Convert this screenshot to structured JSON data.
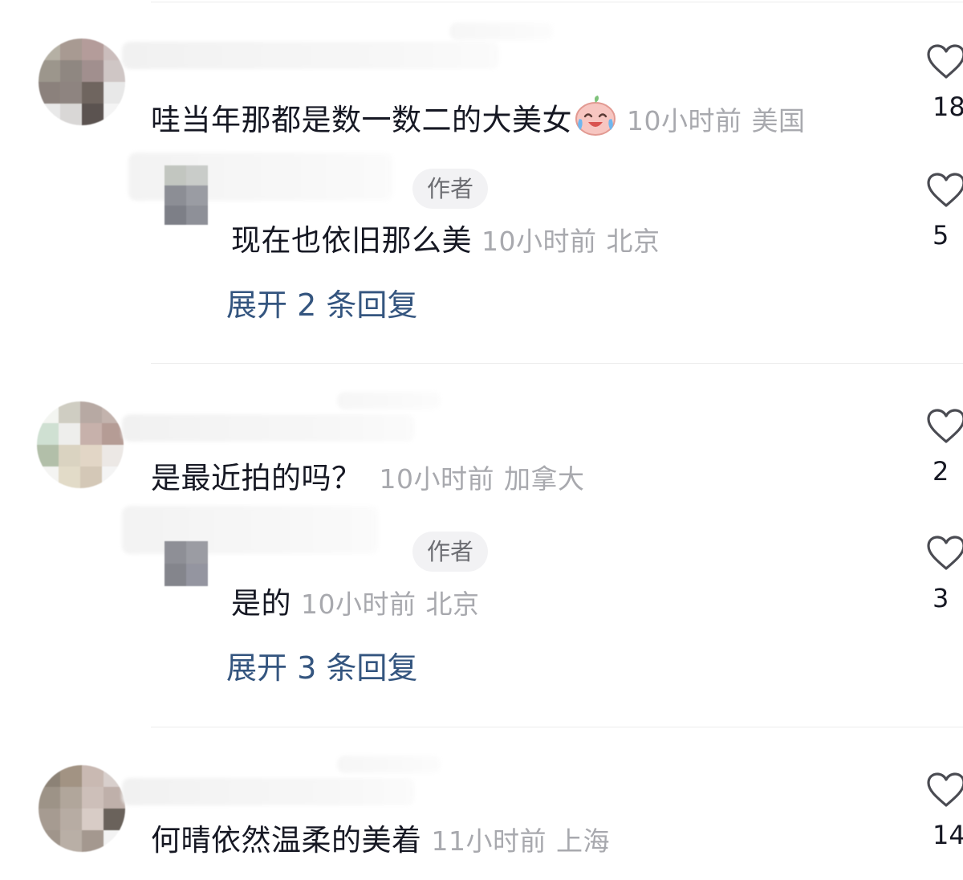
{
  "comments": [
    {
      "text": "哇当年那都是数一数二的大美女",
      "emoji": "crying-laughing-emoji",
      "time": "10小时前",
      "location": "美国",
      "likes": "18",
      "reply": {
        "author_tag": "作者",
        "text": "现在也依旧那么美",
        "time": "10小时前",
        "location": "北京",
        "likes": "5"
      },
      "expand_label": "展开 2 条回复"
    },
    {
      "text": "是最近拍的吗？",
      "time": "10小时前",
      "location": "加拿大",
      "likes": "2",
      "reply": {
        "author_tag": "作者",
        "text": "是的",
        "time": "10小时前",
        "location": "北京",
        "likes": "3"
      },
      "expand_label": "展开 3 条回复"
    },
    {
      "text": "何晴依然温柔的美着",
      "time": "11小时前",
      "location": "上海",
      "likes": "14"
    }
  ],
  "colors": {
    "primary_text": "#161823",
    "meta_text": "#a8a9ae",
    "expand_link": "#34557f",
    "tag_bg": "#f2f2f4",
    "divider": "#ececec"
  },
  "icons": {
    "like": "heart-outline-icon"
  }
}
